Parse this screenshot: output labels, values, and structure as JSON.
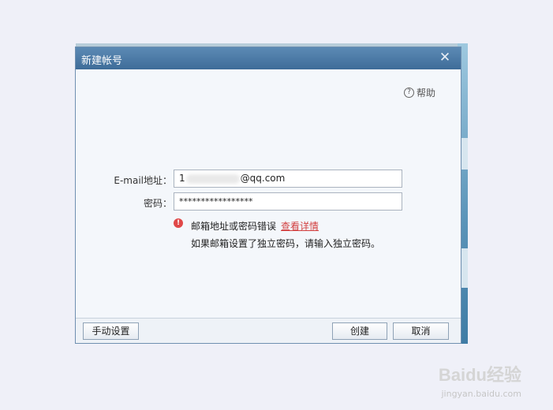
{
  "dialog": {
    "title": "新建帐号",
    "close_glyph": "✕",
    "help_label": "帮助",
    "help_glyph": "?"
  },
  "form": {
    "email_label": "E-mail地址：",
    "email_prefix": "1",
    "email_suffix": "@qq.com",
    "password_label": "密码：",
    "password_value": "*****************"
  },
  "error": {
    "icon_glyph": "!",
    "message": "邮箱地址或密码错误",
    "details_link": "查看详情",
    "hint": "如果邮箱设置了独立密码，请输入独立密码。"
  },
  "buttons": {
    "manual_setup": "手动设置",
    "create": "创建",
    "cancel": "取消"
  },
  "watermark": {
    "logo_text": "Baidu经验",
    "url": "jingyan.baidu.com"
  },
  "colors": {
    "titlebar": "#4a78a6",
    "error": "#d24040"
  }
}
